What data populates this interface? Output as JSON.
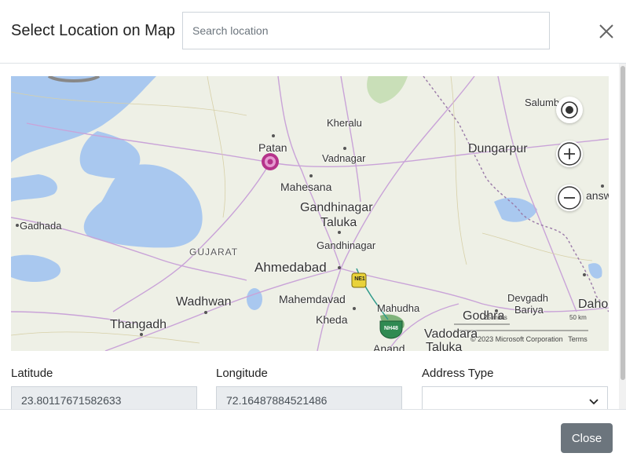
{
  "header": {
    "title": "Select Location on Map",
    "search_placeholder": "Search location"
  },
  "map": {
    "labels": {
      "salumbar": "Salumb",
      "kheralu": "Kheralu",
      "patan": "Patan",
      "vadnagar": "Vadnagar",
      "dungarpur": "Dungarpur",
      "mahesana": "Mahesana",
      "gandhinagar_taluka_1": "Gandhinagar",
      "gandhinagar_taluka_2": "Taluka",
      "gadhada": "Gadhada",
      "gujarat": "GUJARAT",
      "gandhinagar": "Gandhinagar",
      "ahmedabad": "Ahmedabad",
      "banswara": "answ",
      "mahemdavad": "Mahemdavad",
      "wadhwan": "Wadhwan",
      "mahudha": "Mahudha",
      "devgadh_bariya_1": "Devgadh",
      "devgadh_bariya_2": "Bariya",
      "dahod": "Dahod",
      "kheda": "Kheda",
      "godhra": "Godhra",
      "thangadh": "Thangadh",
      "vadodara_taluka_1": "Vadodara",
      "vadodara_taluka_2": "Taluka",
      "anand": "Anand",
      "ne1_shield": "NE1",
      "nh48_shield": "NH48"
    },
    "copyright": "© 2023 Microsoft Corporation",
    "terms": "Terms",
    "scale_miles": "25 miles",
    "scale_km": "50 km",
    "controls": {
      "locate": "locate-me",
      "zoom_in": "zoom-in",
      "zoom_out": "zoom-out"
    }
  },
  "form": {
    "latitude_label": "Latitude",
    "latitude_value": "23.80117671582633",
    "longitude_label": "Longitude",
    "longitude_value": "72.16487884521486",
    "address_type_label": "Address Type",
    "address_type_value": ""
  },
  "footer": {
    "close_label": "Close"
  },
  "colors": {
    "water": "#a9c8ef",
    "land": "#eef0e6",
    "pin": "#b5338a",
    "close_button": "#6c757d"
  }
}
